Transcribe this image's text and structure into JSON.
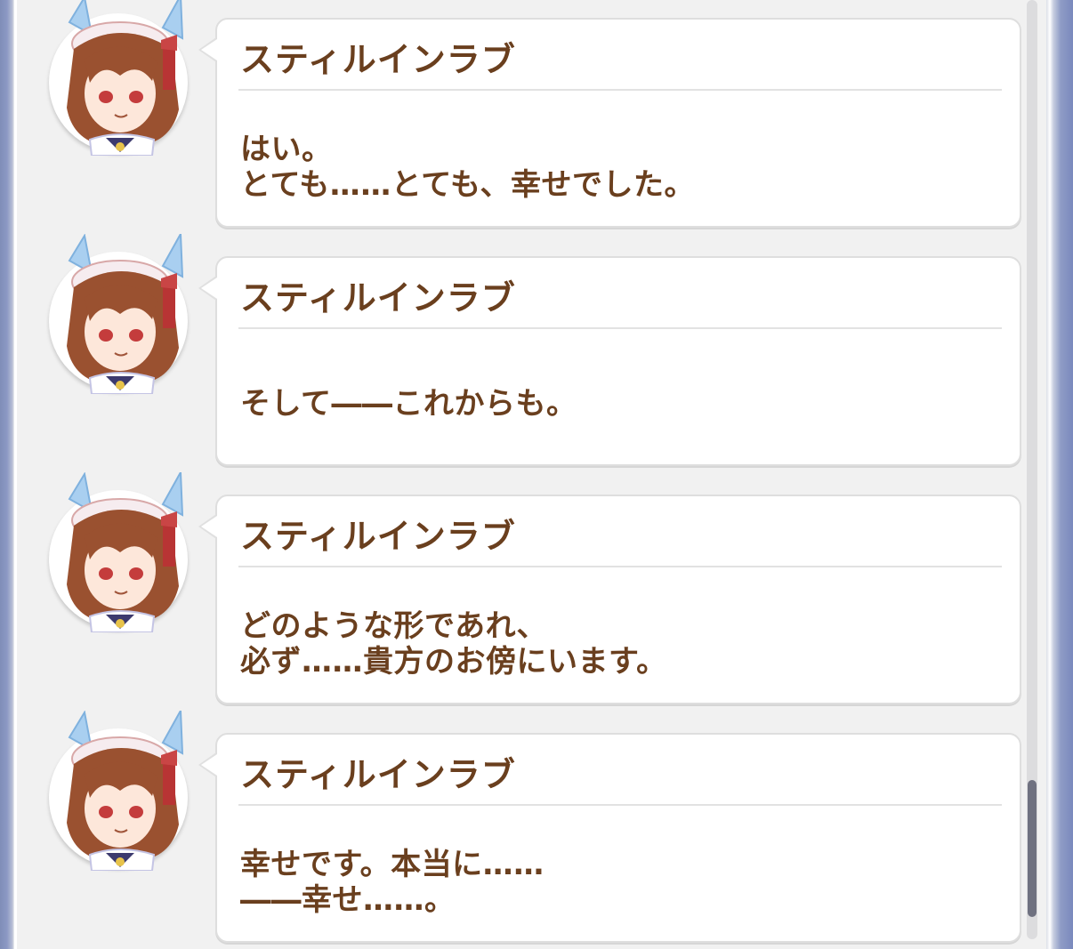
{
  "log": {
    "entries": [
      {
        "speaker": "スティルインラブ",
        "lines": [
          "はい。",
          "とても……とても、幸せでした。"
        ]
      },
      {
        "speaker": "スティルインラブ",
        "lines": [
          "そして――これからも。"
        ]
      },
      {
        "speaker": "スティルインラブ",
        "lines": [
          "どのような形であれ、",
          "必ず……貴方のお傍にいます。"
        ]
      },
      {
        "speaker": "スティルインラブ",
        "lines": [
          "幸せです。本当に……",
          "――幸せ……。"
        ]
      }
    ]
  },
  "colors": {
    "text_brown": "#6a3f1e",
    "panel_bg": "#f1f1f1",
    "bubble_bg": "#ffffff",
    "scroll_thumb": "#6f7180"
  },
  "icons": {
    "avatar": "character-portrait-icon"
  }
}
